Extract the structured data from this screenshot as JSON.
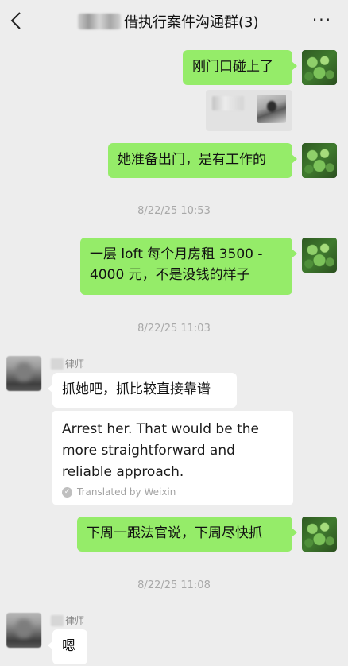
{
  "header": {
    "title": "借执行案件沟通群(3)",
    "more_label": "···"
  },
  "messages": {
    "m1_text": "刚门口碰上了",
    "m2_text": "她准备出门，是有工作的",
    "time1": "8/22/25 10:53",
    "m3_text": "一层 loft 每个月房租 3500 - 4000 元，不是没钱的样子",
    "time2": "8/22/25 11:03",
    "sender_name": "律师",
    "m4_text": "抓她吧，抓比较直接靠谱",
    "translation_text": "Arrest her. That would be the more straightforward and reliable approach.",
    "translated_by": "Translated by Weixin",
    "m5_text": "下周一跟法官说，下周尽快抓",
    "time3": "8/22/25 11:08",
    "sender_name2": "律师",
    "m6_text": "嗯"
  },
  "colors": {
    "background": "#ededed",
    "my_bubble": "#95ec69",
    "other_bubble": "#ffffff"
  },
  "icons": {
    "back": "chevron-left-icon",
    "more": "more-icon"
  }
}
